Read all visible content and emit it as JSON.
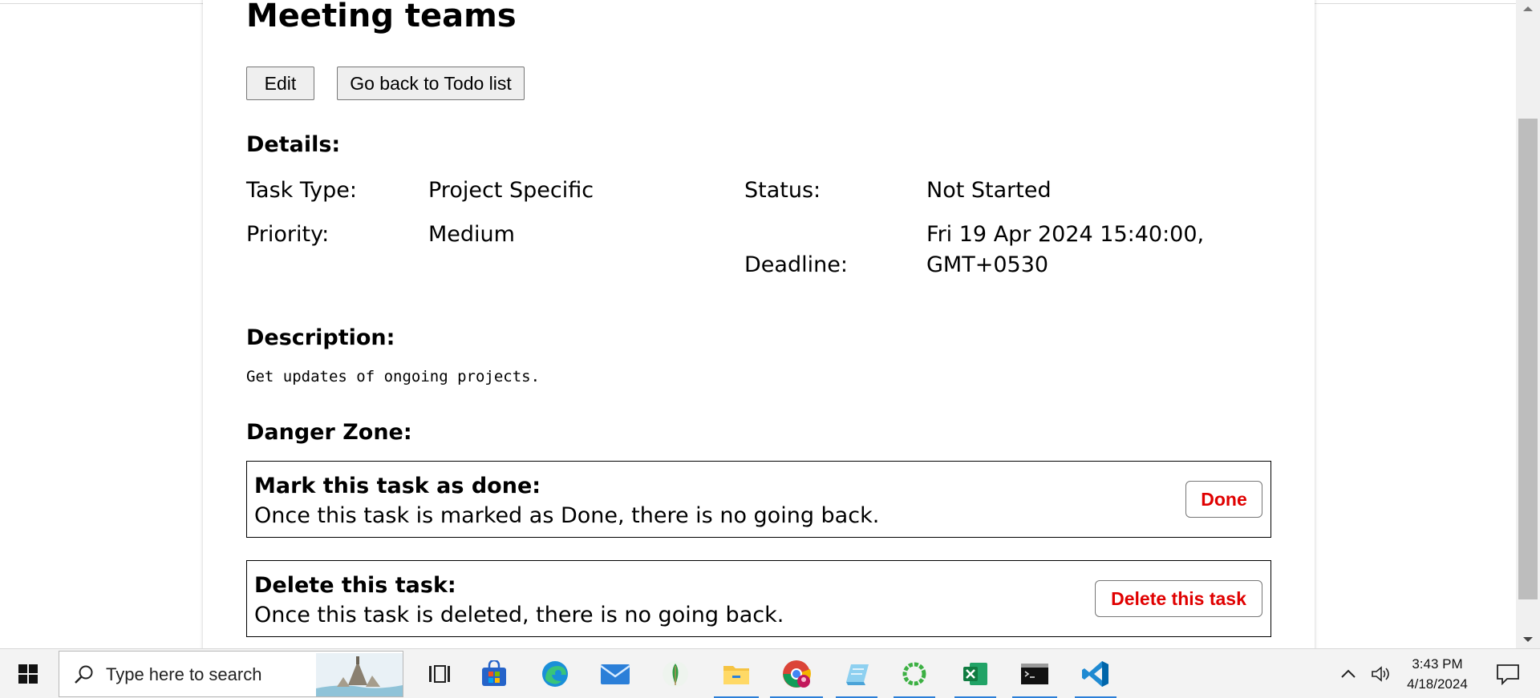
{
  "page": {
    "title": "Meeting teams",
    "buttons": {
      "edit": "Edit",
      "back": "Go back to Todo list"
    },
    "details_heading": "Details:",
    "details": {
      "task_type_label": "Task Type:",
      "task_type": "Project Specific",
      "status_label": "Status:",
      "status": "Not Started",
      "priority_label": "Priority:",
      "priority": "Medium",
      "deadline_label": "Deadline:",
      "deadline_line1": "Fri 19 Apr 2024 15:40:00,",
      "deadline_line2": "GMT+0530"
    },
    "description_heading": "Description:",
    "description": "Get updates of ongoing projects.",
    "danger_heading": "Danger Zone:",
    "danger": {
      "done_title": "Mark this task as done:",
      "done_text": "Once this task is marked as Done, there is no going back.",
      "done_button": "Done",
      "delete_title": "Delete this task:",
      "delete_text": "Once this task is deleted, there is no going back.",
      "delete_button": "Delete this task"
    }
  },
  "colors": {
    "danger": "#e00000",
    "accent": "#2b7fd8"
  },
  "taskbar": {
    "search_placeholder": "Type here to search",
    "time": "3:43 PM",
    "date": "4/18/2024",
    "apps": [
      "task-view-icon",
      "store-icon",
      "edge-icon",
      "mail-icon",
      "mongodb-icon",
      "file-explorer-icon",
      "chrome-icon",
      "notepad-icon",
      "refresh-app-icon",
      "excel-icon",
      "terminal-icon",
      "vscode-icon"
    ]
  }
}
